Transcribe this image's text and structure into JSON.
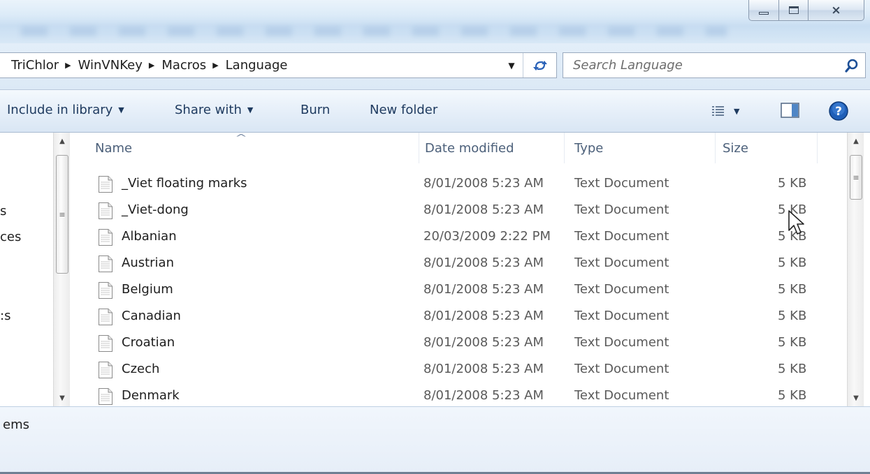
{
  "window": {
    "caption_close": "⨯"
  },
  "address_bar": {
    "crumbs": [
      "TriChlor",
      "WinVNKey",
      "Macros",
      "Language"
    ],
    "separator": "▶",
    "dropdown_glyph": "▼"
  },
  "search": {
    "placeholder": "Search Language",
    "icon": "magnifier-icon"
  },
  "toolbar": {
    "include_in_library": "Include in library",
    "share_with": "Share with",
    "burn": "Burn",
    "new_folder": "New folder",
    "dropdown_glyph": "▼"
  },
  "nav": {
    "fragments": [
      "s",
      "ces",
      ":s"
    ]
  },
  "columns": {
    "name": "Name",
    "date_modified": "Date modified",
    "type": "Type",
    "size": "Size"
  },
  "files": [
    {
      "name": "_Viet floating marks",
      "date": "8/01/2008 5:23 AM",
      "type": "Text Document",
      "size": "5 KB"
    },
    {
      "name": "_Viet-dong",
      "date": "8/01/2008 5:23 AM",
      "type": "Text Document",
      "size": "5 KB"
    },
    {
      "name": "Albanian",
      "date": "20/03/2009 2:22 PM",
      "type": "Text Document",
      "size": "5 KB"
    },
    {
      "name": "Austrian",
      "date": "8/01/2008 5:23 AM",
      "type": "Text Document",
      "size": "5 KB"
    },
    {
      "name": "Belgium",
      "date": "8/01/2008 5:23 AM",
      "type": "Text Document",
      "size": "5 KB"
    },
    {
      "name": "Canadian",
      "date": "8/01/2008 5:23 AM",
      "type": "Text Document",
      "size": "5 KB"
    },
    {
      "name": "Croatian",
      "date": "8/01/2008 5:23 AM",
      "type": "Text Document",
      "size": "5 KB"
    },
    {
      "name": "Czech",
      "date": "8/01/2008 5:23 AM",
      "type": "Text Document",
      "size": "5 KB"
    },
    {
      "name": "Denmark",
      "date": "8/01/2008 5:23 AM",
      "type": "Text Document",
      "size": "5 KB"
    }
  ],
  "details": {
    "count_text": "ems"
  },
  "colors": {
    "accent": "#1e3a5f",
    "help_blue": "#1f5fb8"
  }
}
